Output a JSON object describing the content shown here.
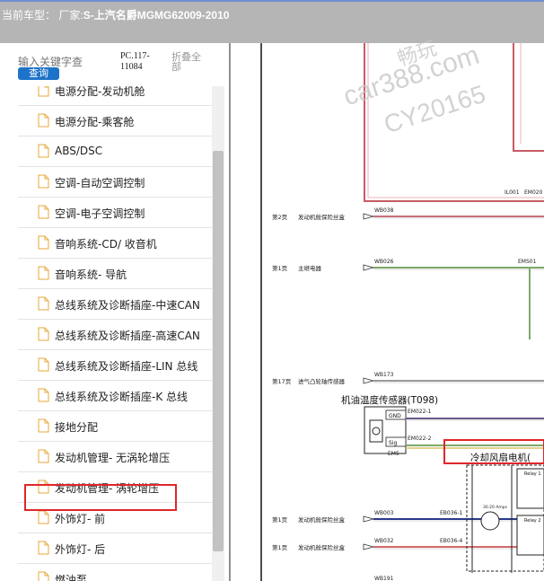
{
  "window": {
    "title_prefix": "当前车型：",
    "title_maker_label": "厂家:",
    "title_model": "S-上汽名爵MGMG62009-2010"
  },
  "search": {
    "placeholder": "输入关键字查",
    "button_label": "查询",
    "pc_code": "PC.117-11084",
    "collapse_label": "折叠全部"
  },
  "tree": {
    "items": [
      {
        "label": "电源分配-发动机舱"
      },
      {
        "label": "电源分配-乘客舱"
      },
      {
        "label": "ABS/DSC"
      },
      {
        "label": "空调-自动空调控制"
      },
      {
        "label": "空调-电子空调控制"
      },
      {
        "label": "音响系统-CD/ 收音机"
      },
      {
        "label": "音响系统- 导航"
      },
      {
        "label": "总线系统及诊断插座-中速CAN"
      },
      {
        "label": "总线系统及诊断插座-高速CAN"
      },
      {
        "label": "总线系统及诊断插座-LIN 总线"
      },
      {
        "label": "总线系统及诊断插座-K 总线"
      },
      {
        "label": "接地分配"
      },
      {
        "label": "发动机管理- 无涡轮增压"
      },
      {
        "label": "发动机管理- 涡轮增压"
      },
      {
        "label": "外饰灯- 前"
      },
      {
        "label": "外饰灯- 后"
      },
      {
        "label": "燃油泵"
      }
    ],
    "highlighted_index": 12
  },
  "diagram": {
    "watermark": [
      "畅玩",
      "car388.com",
      "CY20165"
    ],
    "rows": [
      {
        "page": "第2页",
        "desc": "发动机舱保险丝盒",
        "wire": "WB038"
      },
      {
        "page": "第1页",
        "desc": "主继电器",
        "wire": "WB026",
        "node": "EMS01"
      },
      {
        "page": "第17页",
        "desc": "进气凸轮轴传感器",
        "wire": "WB173"
      },
      {
        "page": "第1页",
        "desc": "发动机舱保险丝盒",
        "wire": "WB003",
        "node": "EB036-1"
      },
      {
        "page": "第1页",
        "desc": "发动机舱保险丝盒",
        "wire": "WB032",
        "node": "EB036-4"
      }
    ],
    "top_nodes": [
      "IL001",
      "EM020"
    ],
    "sensor_title": "机油温度传感器(T098)",
    "sensor_pins": [
      "GND",
      "Sig"
    ],
    "sensor_wires": [
      "EM022-1",
      "EM022-2"
    ],
    "sensor_node": "EM5",
    "fan_title": "冷却风扇电机(",
    "relay_labels": [
      "Relay 1",
      "Relay 2"
    ],
    "fuse_label": "30.20 Amps",
    "bottom_wire": "WB191"
  }
}
